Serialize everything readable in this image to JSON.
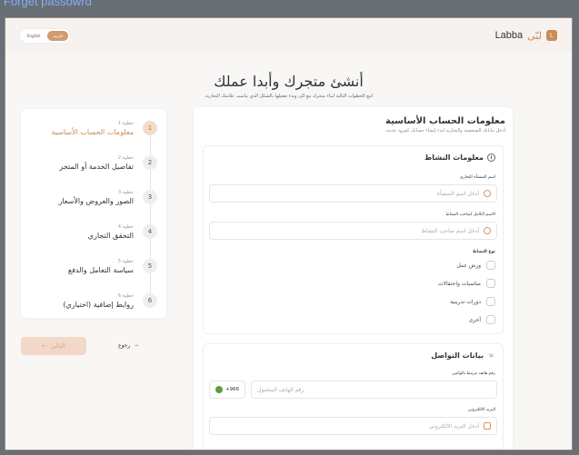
{
  "window": {
    "title": "Forget passowrd"
  },
  "header": {
    "lang_en": "English",
    "lang_ar": "العربية",
    "brand_ar": "لبّى",
    "brand_en": "Labba",
    "logo_letter": "L"
  },
  "hero": {
    "title": "أنشئ متجرك وأبدا عملك",
    "subtitle": "اتبع الخطوات التالية لبناء متجرك مع لبّى وبدء تفعيلها بالشكل الذي يناسب علامتك التجارية."
  },
  "steps": [
    {
      "number": "1",
      "small": "خطوة 1",
      "label": "معلومات الحساب الأساسية"
    },
    {
      "number": "2",
      "small": "خطوة 2",
      "label": "تفاصيل الخدمة أو المتجر"
    },
    {
      "number": "3",
      "small": "خطوة 3",
      "label": "الصور والعروض والأسعار"
    },
    {
      "number": "4",
      "small": "خطوة 4",
      "label": "التحقق التجاري"
    },
    {
      "number": "5",
      "small": "خطوة 5",
      "label": "سياسة التعامل والدفع"
    },
    {
      "number": "6",
      "small": "خطوة 6",
      "label": "روابط إضافية (اختياري)"
    }
  ],
  "nav": {
    "prev": "التالي",
    "next": "رجوع",
    "prev_arrow": "←",
    "next_arrow": "→"
  },
  "form": {
    "title": "معلومات الحساب الأساسية",
    "subtitle": "أدخل بياناتك الشخصية والتجارية لبدء إنشاء حسابك كمزود خدمة.",
    "activity": {
      "title": "معلومات النشاط",
      "name_label": "اسم المنشأة التجاري",
      "name_placeholder": "أدخل اسم المنشأة",
      "owner_label": "الاسم الكامل لصاحب النشاط",
      "owner_placeholder": "أدخل اسم صاحب النشاط",
      "type_label": "نوع النشاط",
      "types": [
        "ورش عمل",
        "مناسبات واحتفالات",
        "دورات تدريبية",
        "أخرى"
      ]
    },
    "contact": {
      "title": "بيانات التواصل",
      "phone_label": "رقم هاتف مرتبط بالواتس",
      "phone_code": "+966",
      "phone_placeholder": "رقم الهاتف المحمول",
      "email_label": "البريد الالكتروني",
      "email_placeholder": "أدخل البريد الالكتروني"
    }
  }
}
